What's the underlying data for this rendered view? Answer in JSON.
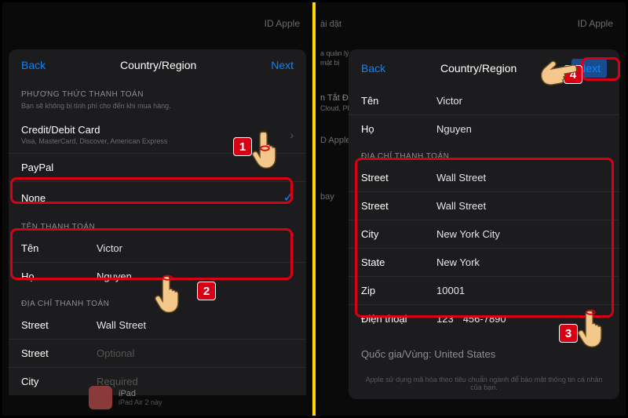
{
  "left": {
    "bg_header": "ID Apple",
    "modal": {
      "back": "Back",
      "title": "Country/Region",
      "next": "Next",
      "pay_method_header": "PHƯƠNG THỨC THANH TOÁN",
      "pay_method_sub": "Bạn sẽ không bị tính phí cho đến khi mua hàng.",
      "credit_label": "Credit/Debit Card",
      "credit_sub": "Visa, MasterCard, Discover, American Express",
      "paypal": "PayPal",
      "none": "None",
      "name_header": "TÊN THANH TOÁN",
      "first_name_lbl": "Tên",
      "first_name_val": "Victor",
      "last_name_lbl": "Họ",
      "last_name_val": "Nguyen",
      "addr_header": "ĐỊA CHỈ THANH TOÁN",
      "street_lbl": "Street",
      "street_val": "Wall Street",
      "street2_lbl": "Street",
      "street2_ph": "Optional",
      "city_lbl": "City",
      "city_ph": "Required"
    },
    "bg_ipad": "iPad",
    "bg_ipad_sub": "iPad Air 2 này"
  },
  "right": {
    "bg_header": "ID Apple",
    "bg_settings": "ài đặt",
    "bg_sub1": "a quản lý",
    "bg_sub2": "mật bị",
    "bg_tat": "n Tắt Đ",
    "bg_cloud": "Cloud, Pho",
    "bg_apple": "D Apple",
    "bg_bay": "bay",
    "modal": {
      "back": "Back",
      "title": "Country/Region",
      "next": "Next",
      "first_name_lbl": "Tên",
      "first_name_val": "Victor",
      "last_name_lbl": "Họ",
      "last_name_val": "Nguyen",
      "addr_header": "ĐỊA CHỈ THANH TOÁN",
      "street_lbl": "Street",
      "street_val": "Wall Street",
      "street2_lbl": "Street",
      "street2_val": "Wall Street",
      "city_lbl": "City",
      "city_val": "New York City",
      "state_lbl": "State",
      "state_val": "New York",
      "zip_lbl": "Zip",
      "zip_val": "10001",
      "phone_lbl": "Điện thoại",
      "phone_area": "123",
      "phone_num": "456-7890",
      "country_row": "Quốc gia/Vùng: United States",
      "footer": "Apple sử dụng mã hóa theo tiêu chuẩn ngành để bảo mật thông tin cá nhân của bạn."
    }
  },
  "annotations": {
    "n1": "1",
    "n2": "2",
    "n3": "3",
    "n4": "4"
  }
}
